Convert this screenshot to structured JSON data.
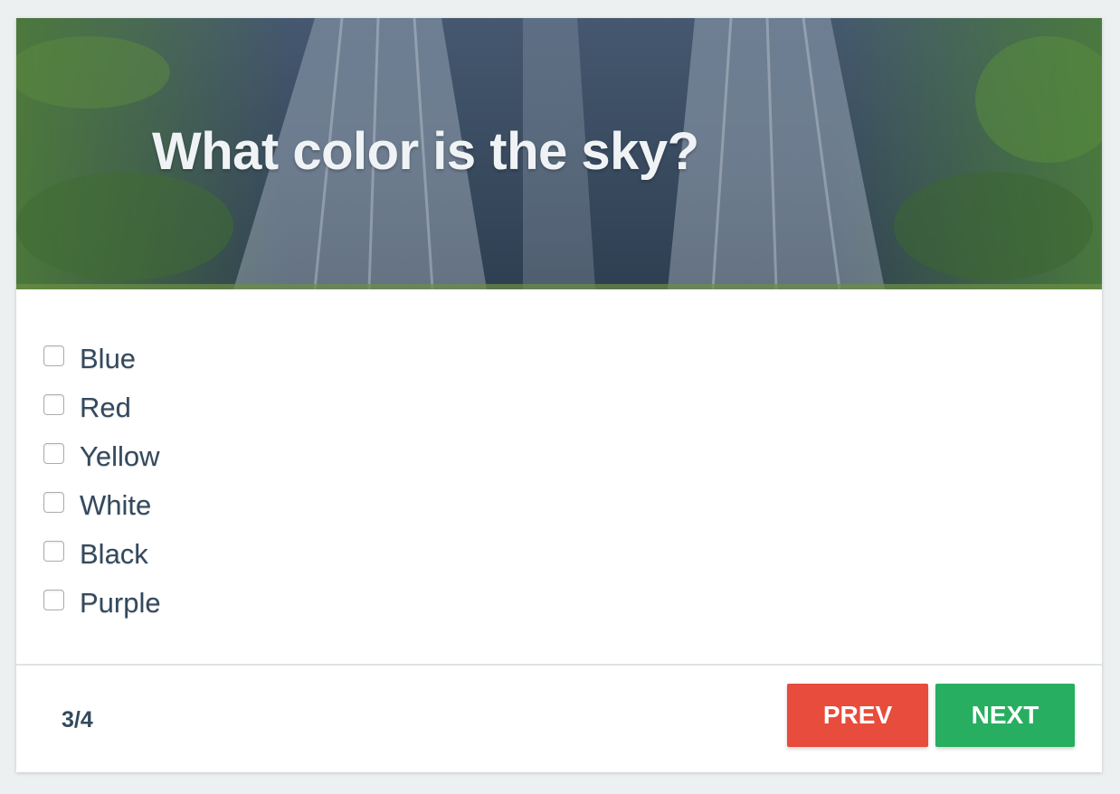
{
  "question": {
    "text": "What color is the sky?"
  },
  "options": [
    {
      "label": "Blue",
      "checked": false
    },
    {
      "label": "Red",
      "checked": false
    },
    {
      "label": "Yellow",
      "checked": false
    },
    {
      "label": "White",
      "checked": false
    },
    {
      "label": "Black",
      "checked": false
    },
    {
      "label": "Purple",
      "checked": false
    }
  ],
  "footer": {
    "progress": "3/4",
    "prev_label": "PREV",
    "next_label": "NEXT"
  },
  "colors": {
    "prev_button": "#e74c3c",
    "next_button": "#27ae60",
    "text": "#34495e",
    "background": "#ecf0f1"
  },
  "header_image": "waterfall-forest-photo"
}
